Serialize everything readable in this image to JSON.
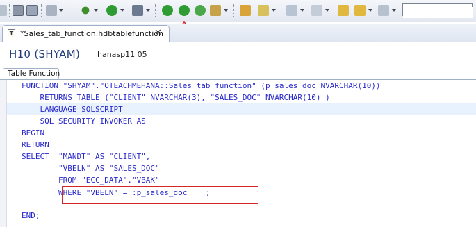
{
  "toolbar": {
    "icons": [
      "file-icon",
      "save-icon",
      "save-all-icon",
      "print-icon",
      "debug-icon",
      "run-icon",
      "stop-icon",
      "activate-icon",
      "activate-all-icon",
      "check-icon",
      "data-preview-icon",
      "open-folder-icon",
      "pin-icon",
      "annotation-icon",
      "bookmark-icon",
      "last-edit-icon",
      "back-icon",
      "forward-icon"
    ],
    "top_clip_text": "",
    "search_value": ""
  },
  "editor_tab": {
    "icon_glyph": "T",
    "title": "*Sales_tab_function.hdbtablefunction",
    "close_glyph": "✕"
  },
  "header": {
    "connection": "H10 (SHYAM)",
    "system": "hanasp11 05"
  },
  "subtab": {
    "label": "Table Function"
  },
  "code": {
    "lines": [
      "FUNCTION \"SHYAM\".\"OTEACHMEHANA::Sales_tab_function\" (p_sales_doc NVARCHAR(10))",
      "    RETURNS TABLE (\"CLIENT\" NVARCHAR(3), \"SALES_DOC\" NVARCHAR(10) )",
      "    LANGUAGE SQLSCRIPT",
      "    SQL SECURITY INVOKER AS",
      "BEGIN",
      "RETURN",
      "SELECT  \"MANDT\" AS \"CLIENT\",",
      "        \"VBELN\" AS \"SALES_DOC\"",
      "        FROM \"ECC_DATA\".\"VBAK\"",
      "        WHERE \"VBELN\" = :p_sales_doc    ;",
      "",
      "END;"
    ]
  },
  "colors": {
    "code_text": "#2a2acb",
    "annotation_red": "#d42626",
    "current_line": "#e8f2fe",
    "header_text": "#1e3a78"
  }
}
